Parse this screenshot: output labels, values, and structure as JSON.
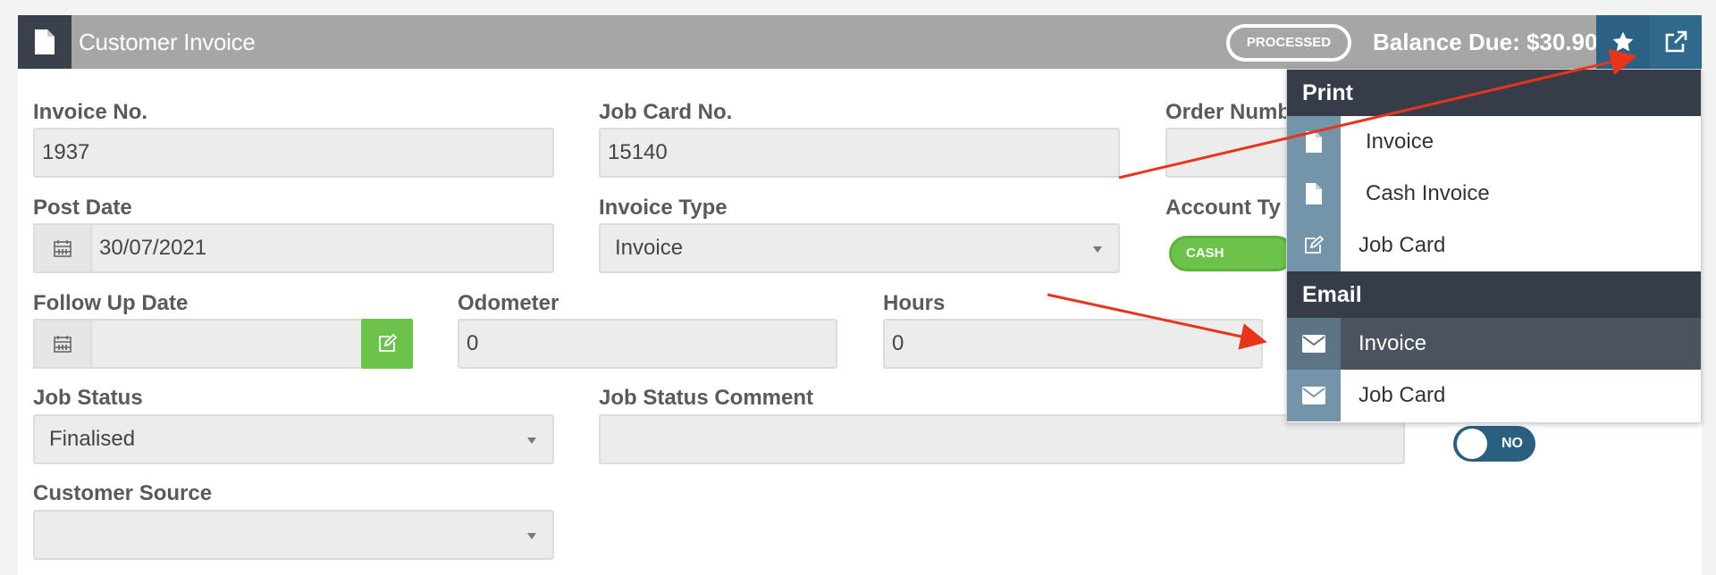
{
  "header": {
    "title": "Customer Invoice",
    "status_badge": "PROCESSED",
    "balance": "Balance Due: $30.90"
  },
  "form": {
    "invoice_no": {
      "label": "Invoice No.",
      "value": "1937"
    },
    "job_card_no": {
      "label": "Job Card No.",
      "value": "15140"
    },
    "order_number": {
      "label": "Order Numb",
      "value": ""
    },
    "post_date": {
      "label": "Post Date",
      "value": "30/07/2021"
    },
    "invoice_type": {
      "label": "Invoice Type",
      "value": "Invoice"
    },
    "account_type": {
      "label": "Account Ty",
      "toggle": "CASH"
    },
    "follow_up_date": {
      "label": "Follow Up Date",
      "value": ""
    },
    "odometer": {
      "label": "Odometer",
      "value": "0"
    },
    "hours": {
      "label": "Hours",
      "value": "0"
    },
    "job_status": {
      "label": "Job Status",
      "value": "Finalised"
    },
    "job_status_comment": {
      "label": "Job Status Comment",
      "value": ""
    },
    "no_toggle": "NO",
    "customer_source": {
      "label": "Customer Source",
      "value": ""
    }
  },
  "dropdown": {
    "print_header": "Print",
    "print_items": [
      "Invoice",
      "Cash Invoice",
      "Job Card"
    ],
    "email_header": "Email",
    "email_items": [
      "Invoice",
      "Job Card"
    ],
    "active_item": "email-invoice"
  },
  "colors": {
    "header_bg": "#a6a6a6",
    "header_btn": "#2b6283",
    "dropdown_head": "#373d48",
    "green": "#6cc24a",
    "arrow": "#e8341c"
  }
}
